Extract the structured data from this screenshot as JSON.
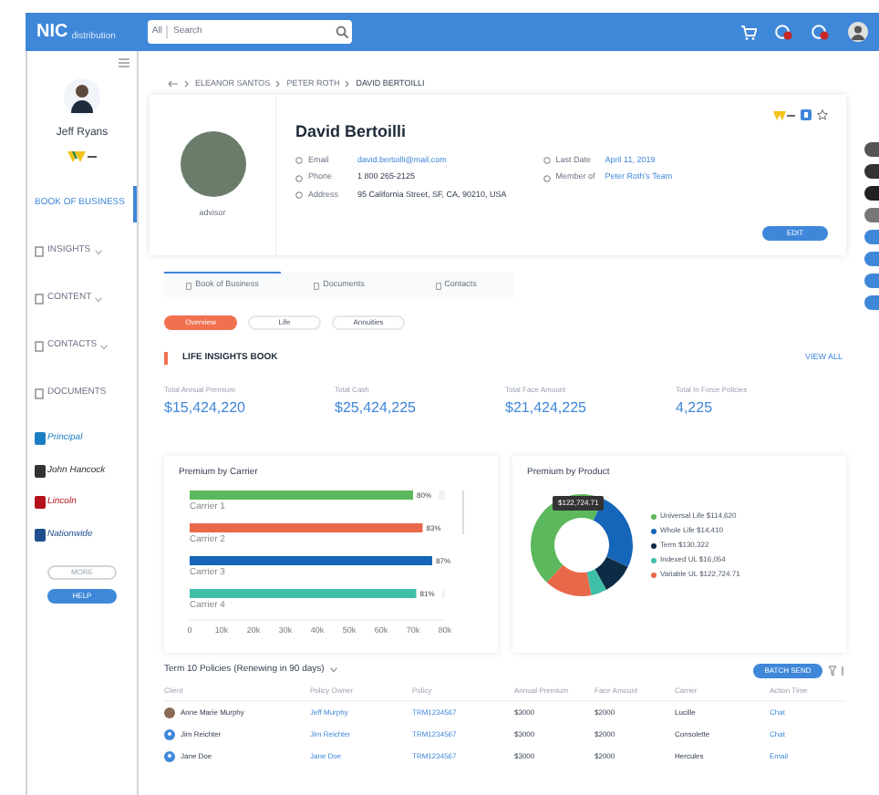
{
  "topbar": {
    "logo": "NIC",
    "logo_sub": "distribution",
    "search_scope": "All",
    "search_placeholder": "Search"
  },
  "sidebar": {
    "user_name": "Jeff Ryans",
    "items": [
      {
        "label": "BOOK OF BUSINESS",
        "selected": true,
        "kind": "plain"
      },
      {
        "label": "INSIGHTS",
        "selected": false,
        "kind": "menu"
      },
      {
        "label": "CONTENT",
        "selected": false,
        "kind": "menu"
      },
      {
        "label": "CONTACTS",
        "selected": false,
        "kind": "menu"
      },
      {
        "label": "DOCUMENTS",
        "selected": false,
        "kind": "doc"
      }
    ],
    "carriers": [
      {
        "label": "Principal",
        "color": "#1a7fc1"
      },
      {
        "label": "John Hancock",
        "color": "#333333"
      },
      {
        "label": "Lincoln",
        "color": "#b5121b"
      },
      {
        "label": "Nationwide",
        "color": "#1f4e8c"
      }
    ],
    "more": "MORE",
    "help": "HELP"
  },
  "breadcrumb": [
    "ELEANOR SANTOS",
    "PETER ROTH",
    "DAVID BERTOILLI"
  ],
  "profile": {
    "name": "David Bertoilli",
    "role": "advisor",
    "fields": [
      {
        "label": "Email",
        "value": "david.bertoilli@mail.com",
        "link": true
      },
      {
        "label": "Phone",
        "value": "1 800 265-2125",
        "link": false
      },
      {
        "label": "Address",
        "value": "95 California Street, SF, CA, 90210, USA",
        "link": false
      }
    ],
    "fields_right": [
      {
        "label": "Last Date",
        "value": "April 11, 2019",
        "link": true
      },
      {
        "label": "Member of",
        "value": "Peter Roth's Team",
        "link": true
      }
    ],
    "edit": "EDIT"
  },
  "tabs": [
    {
      "label": "Book of Business",
      "selected": true
    },
    {
      "label": "Documents",
      "selected": false
    },
    {
      "label": "Contacts",
      "selected": false
    }
  ],
  "pills": [
    {
      "label": "Overview",
      "selected": true
    },
    {
      "label": "Life",
      "selected": false
    },
    {
      "label": "Annuities",
      "selected": false
    }
  ],
  "section": {
    "title": "LIFE INSIGHTS BOOK",
    "view_all": "VIEW ALL"
  },
  "stats": [
    {
      "label": "Total Annual Premium",
      "value": "$15,424,220"
    },
    {
      "label": "Total Cash",
      "value": "$25,424,225"
    },
    {
      "label": "Total Face Amount",
      "value": "$21,424,225"
    },
    {
      "label": "Total In Force Policies",
      "value": "4,225"
    }
  ],
  "carrier_chart": {
    "chart_data": {
      "type": "bar",
      "orientation": "horizontal",
      "title": "Premium by Carrier",
      "categories": [
        "Carrier 1",
        "Carrier 2",
        "Carrier 3",
        "Carrier 4"
      ],
      "series": [
        {
          "values": [
            70,
            73,
            76,
            71
          ]
        }
      ],
      "colors": [
        "#5cb85c",
        "#e8684a",
        "#1565b8",
        "#3fbfa8"
      ],
      "value_labels": [
        "80%",
        "83%",
        "87%",
        "81%"
      ],
      "xlim": [
        0,
        80
      ],
      "xticks": [
        {
          "value": 0,
          "label": "0"
        },
        {
          "value": 10,
          "label": "10k"
        },
        {
          "value": 20,
          "label": "20k"
        },
        {
          "value": 30,
          "label": "30k"
        },
        {
          "value": 40,
          "label": "40k"
        },
        {
          "value": 50,
          "label": "50k"
        },
        {
          "value": 60,
          "label": "60k"
        },
        {
          "value": 70,
          "label": "70k"
        },
        {
          "value": 80,
          "label": "80k"
        }
      ]
    }
  },
  "product_chart": {
    "tooltip": "$122,724.71",
    "chart_data": {
      "type": "donut",
      "title": "Premium by Product",
      "legend": "right",
      "categories": [
        "Universal Life $114,620",
        "Whole Life $14,410",
        "Term $130,322",
        "Indexed UL $16,054",
        "Variable UL $122,724.71"
      ],
      "series": [
        {
          "values": [
            45,
            25,
            10,
            5,
            15
          ]
        }
      ],
      "colors": [
        "#5cb85c",
        "#1565b8",
        "#0d2b45",
        "#3fbfa8",
        "#e8684a"
      ]
    }
  },
  "table": {
    "title": "Term 10 Policies (Renewing in 90 days)",
    "batch": "BATCH SEND",
    "columns": [
      "Client",
      "Policy Owner",
      "Policy",
      "Annual Premium",
      "Face Amount",
      "Carrier",
      "Action Time"
    ],
    "rows": [
      {
        "client": "Anne Marie Murphy",
        "kind": "photo",
        "owner": "Jeff Murphy",
        "policy": "TRM1234567",
        "premium": "$3000",
        "face": "$2000",
        "carrier": "Lucille",
        "action": "Chat"
      },
      {
        "client": "Jim Reichter",
        "kind": "icon",
        "owner": "Jim Reichter",
        "policy": "TRM1234567",
        "premium": "$3000",
        "face": "$2000",
        "carrier": "Consolette",
        "action": "Chat"
      },
      {
        "client": "Jane Doe",
        "kind": "icon",
        "owner": "Jane Doe",
        "policy": "TRM1234567",
        "premium": "$3000",
        "face": "$2000",
        "carrier": "Hercules",
        "action": "Email"
      }
    ]
  }
}
